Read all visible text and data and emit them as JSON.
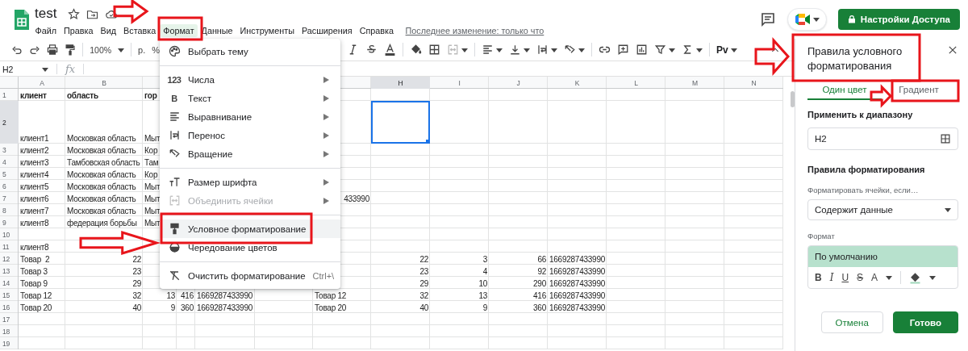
{
  "document": {
    "title": "test",
    "menus": [
      {
        "label": "Файл",
        "selected": false
      },
      {
        "label": "Правка",
        "selected": false
      },
      {
        "label": "Вид",
        "selected": false
      },
      {
        "label": "Вставка",
        "selected": false
      },
      {
        "label": "Формат",
        "selected": true
      },
      {
        "label": "Данные",
        "selected": false
      },
      {
        "label": "Инструменты",
        "selected": false
      },
      {
        "label": "Расширения",
        "selected": false
      },
      {
        "label": "Справка",
        "selected": false
      }
    ],
    "last_edit": "Последнее изменение: только что",
    "share_button": "Настройки Доступа"
  },
  "toolbar": {
    "zoom": "100%",
    "currency": "р.",
    "percent": "%",
    "extension": "Pv"
  },
  "formula_bar": {
    "cell_ref": "H2",
    "fx": "fx"
  },
  "sheet": {
    "columns": [
      {
        "label": "A"
      },
      {
        "label": "B"
      },
      {},
      {},
      {},
      {},
      {},
      {
        "label": "H"
      },
      {
        "label": "I"
      },
      {
        "label": "J"
      },
      {
        "label": "K"
      },
      {
        "label": "L"
      },
      {
        "label": "M"
      },
      {
        "label": "N"
      }
    ],
    "rows": [
      {
        "number": "1",
        "cells": [
          {
            "text": "клиент",
            "bold": true
          },
          {
            "text": "область",
            "bold": true
          },
          {
            "text": "гор",
            "bold": true
          }
        ]
      },
      {
        "number": "2",
        "cells": [
          {
            "text": "клиент1"
          },
          {
            "text": "Московкая область"
          },
          {
            "text": "Мыт"
          },
          {},
          {},
          {},
          {},
          {
            "selected": true
          }
        ]
      },
      {
        "number": "3",
        "cells": [
          {
            "text": "клиент2"
          },
          {
            "text": "Московкая область"
          },
          {
            "text": "Кор"
          }
        ]
      },
      {
        "number": "4",
        "cells": [
          {
            "text": "клиент3"
          },
          {
            "text": "Тамбовская область"
          },
          {
            "text": "Там"
          }
        ]
      },
      {
        "number": "5",
        "cells": [
          {
            "text": "клиент4"
          },
          {
            "text": "Московкая область"
          },
          {
            "text": "Кор"
          }
        ]
      },
      {
        "number": "6",
        "cells": [
          {
            "text": "клиент5"
          },
          {
            "text": "Московкая область"
          },
          {
            "text": "Мыт"
          }
        ]
      },
      {
        "number": "7",
        "cells": [
          {
            "text": "клиент6"
          },
          {
            "text": "Московкая область"
          },
          {
            "text": "Мыт"
          },
          {},
          {},
          {},
          {
            "text": "433990",
            "kind": "number"
          }
        ]
      },
      {
        "number": "8",
        "cells": [
          {
            "text": "клиент7"
          },
          {
            "text": "Московкая область"
          },
          {
            "text": "Мыт"
          }
        ]
      },
      {
        "number": "9",
        "cells": [
          {
            "text": "клиент8"
          },
          {
            "text": "федерация борьбы"
          },
          {
            "text": "Мыт"
          }
        ]
      },
      {
        "number": "10",
        "cells": []
      },
      {
        "number": "11",
        "cells": [
          {
            "text": "клиент8"
          }
        ]
      },
      {
        "number": "12",
        "cells": [
          {
            "text": "Товар  2"
          },
          {
            "text": "22",
            "kind": "number"
          },
          {},
          {},
          {},
          {},
          {},
          {
            "text": "22",
            "kind": "number"
          },
          {
            "text": "3",
            "kind": "number"
          },
          {
            "text": "66",
            "kind": "number"
          },
          {
            "text": "1669287433990"
          }
        ]
      },
      {
        "number": "13",
        "cells": [
          {
            "text": "Товар 3"
          },
          {
            "text": "23",
            "kind": "number"
          },
          {},
          {},
          {},
          {},
          {},
          {
            "text": "23",
            "kind": "number"
          },
          {
            "text": "4",
            "kind": "number"
          },
          {
            "text": "92",
            "kind": "number"
          },
          {
            "text": "1669287433990"
          }
        ]
      },
      {
        "number": "14",
        "cells": [
          {
            "text": "Товар 9"
          },
          {
            "text": "29",
            "kind": "number"
          },
          {},
          {},
          {},
          {},
          {},
          {
            "text": "29",
            "kind": "number"
          },
          {
            "text": "10",
            "kind": "number"
          },
          {
            "text": "290",
            "kind": "number"
          },
          {
            "text": "1669287433990"
          }
        ]
      },
      {
        "number": "15",
        "cells": [
          {
            "text": "Товар 12"
          },
          {
            "text": "32",
            "kind": "number"
          },
          {
            "text": "13",
            "kind": "number"
          },
          {
            "text": "416",
            "kind": "number"
          },
          {
            "text": "1669287433990"
          },
          {},
          {
            "text": "Товар 12"
          },
          {
            "text": "32",
            "kind": "number"
          },
          {
            "text": "13",
            "kind": "number"
          },
          {
            "text": "416",
            "kind": "number"
          },
          {
            "text": "1669287433990"
          }
        ]
      },
      {
        "number": "16",
        "cells": [
          {
            "text": "Товар 20"
          },
          {
            "text": "40",
            "kind": "number"
          },
          {
            "text": "9",
            "kind": "number"
          },
          {
            "text": "360",
            "kind": "number"
          },
          {
            "text": "1669287433990"
          },
          {},
          {
            "text": "Товар 20"
          },
          {
            "text": "40",
            "kind": "number"
          },
          {
            "text": "9",
            "kind": "number"
          },
          {
            "text": "360",
            "kind": "number"
          },
          {
            "text": "1669287433990"
          }
        ]
      },
      {
        "number": "17",
        "cells": []
      },
      {
        "number": "18",
        "cells": []
      },
      {
        "number": "19",
        "cells": []
      }
    ]
  },
  "format_menu": {
    "items": [
      {
        "kind": "item",
        "label": "Выбрать тему",
        "submenu": false,
        "disabled": false,
        "selected": false
      },
      {
        "kind": "divider"
      },
      {
        "kind": "item",
        "glyph": "123",
        "label": "Числа",
        "submenu": true,
        "disabled": false,
        "selected": false
      },
      {
        "kind": "item",
        "glyph": "B",
        "label": "Текст",
        "submenu": true,
        "disabled": false,
        "selected": false
      },
      {
        "kind": "item",
        "label": "Выравнивание",
        "submenu": true,
        "disabled": false,
        "selected": false
      },
      {
        "kind": "item",
        "label": "Перенос",
        "submenu": true,
        "disabled": false,
        "selected": false
      },
      {
        "kind": "item",
        "label": "Вращение",
        "submenu": true,
        "disabled": false,
        "selected": false
      },
      {
        "kind": "divider"
      },
      {
        "kind": "item",
        "label": "Размер шрифта",
        "submenu": true,
        "disabled": false,
        "selected": false
      },
      {
        "kind": "item",
        "label": "Объединить ячейки",
        "submenu": true,
        "disabled": true,
        "selected": false
      },
      {
        "kind": "divider"
      },
      {
        "kind": "item",
        "label": "Условное форматирование",
        "submenu": false,
        "disabled": false,
        "selected": true
      },
      {
        "kind": "item",
        "label": "Чередование цветов",
        "submenu": false,
        "disabled": false,
        "selected": false
      },
      {
        "kind": "divider"
      },
      {
        "kind": "item",
        "label": "Очистить форматирование",
        "shortcut": "Ctrl+\\",
        "disabled": false,
        "selected": false
      }
    ]
  },
  "panel": {
    "title": "Правила условного форматирования",
    "tabs": [
      {
        "label": "Один цвет",
        "selected": true
      },
      {
        "label": "Градиент",
        "selected": false
      }
    ],
    "range_label": "Применить к диапазону",
    "range_value": "H2",
    "rules_heading": "Правила форматирования",
    "condition_label": "Форматировать ячейки, если…",
    "condition_value": "Содержит данные",
    "format_label": "Формат",
    "format_preview": "По умолчанию",
    "format_tools": [
      "B",
      "I",
      "U",
      "S",
      "A"
    ],
    "buttons": [
      {
        "label": "Отмена",
        "kind": "secondary"
      },
      {
        "label": "Готово",
        "kind": "primary"
      }
    ]
  }
}
